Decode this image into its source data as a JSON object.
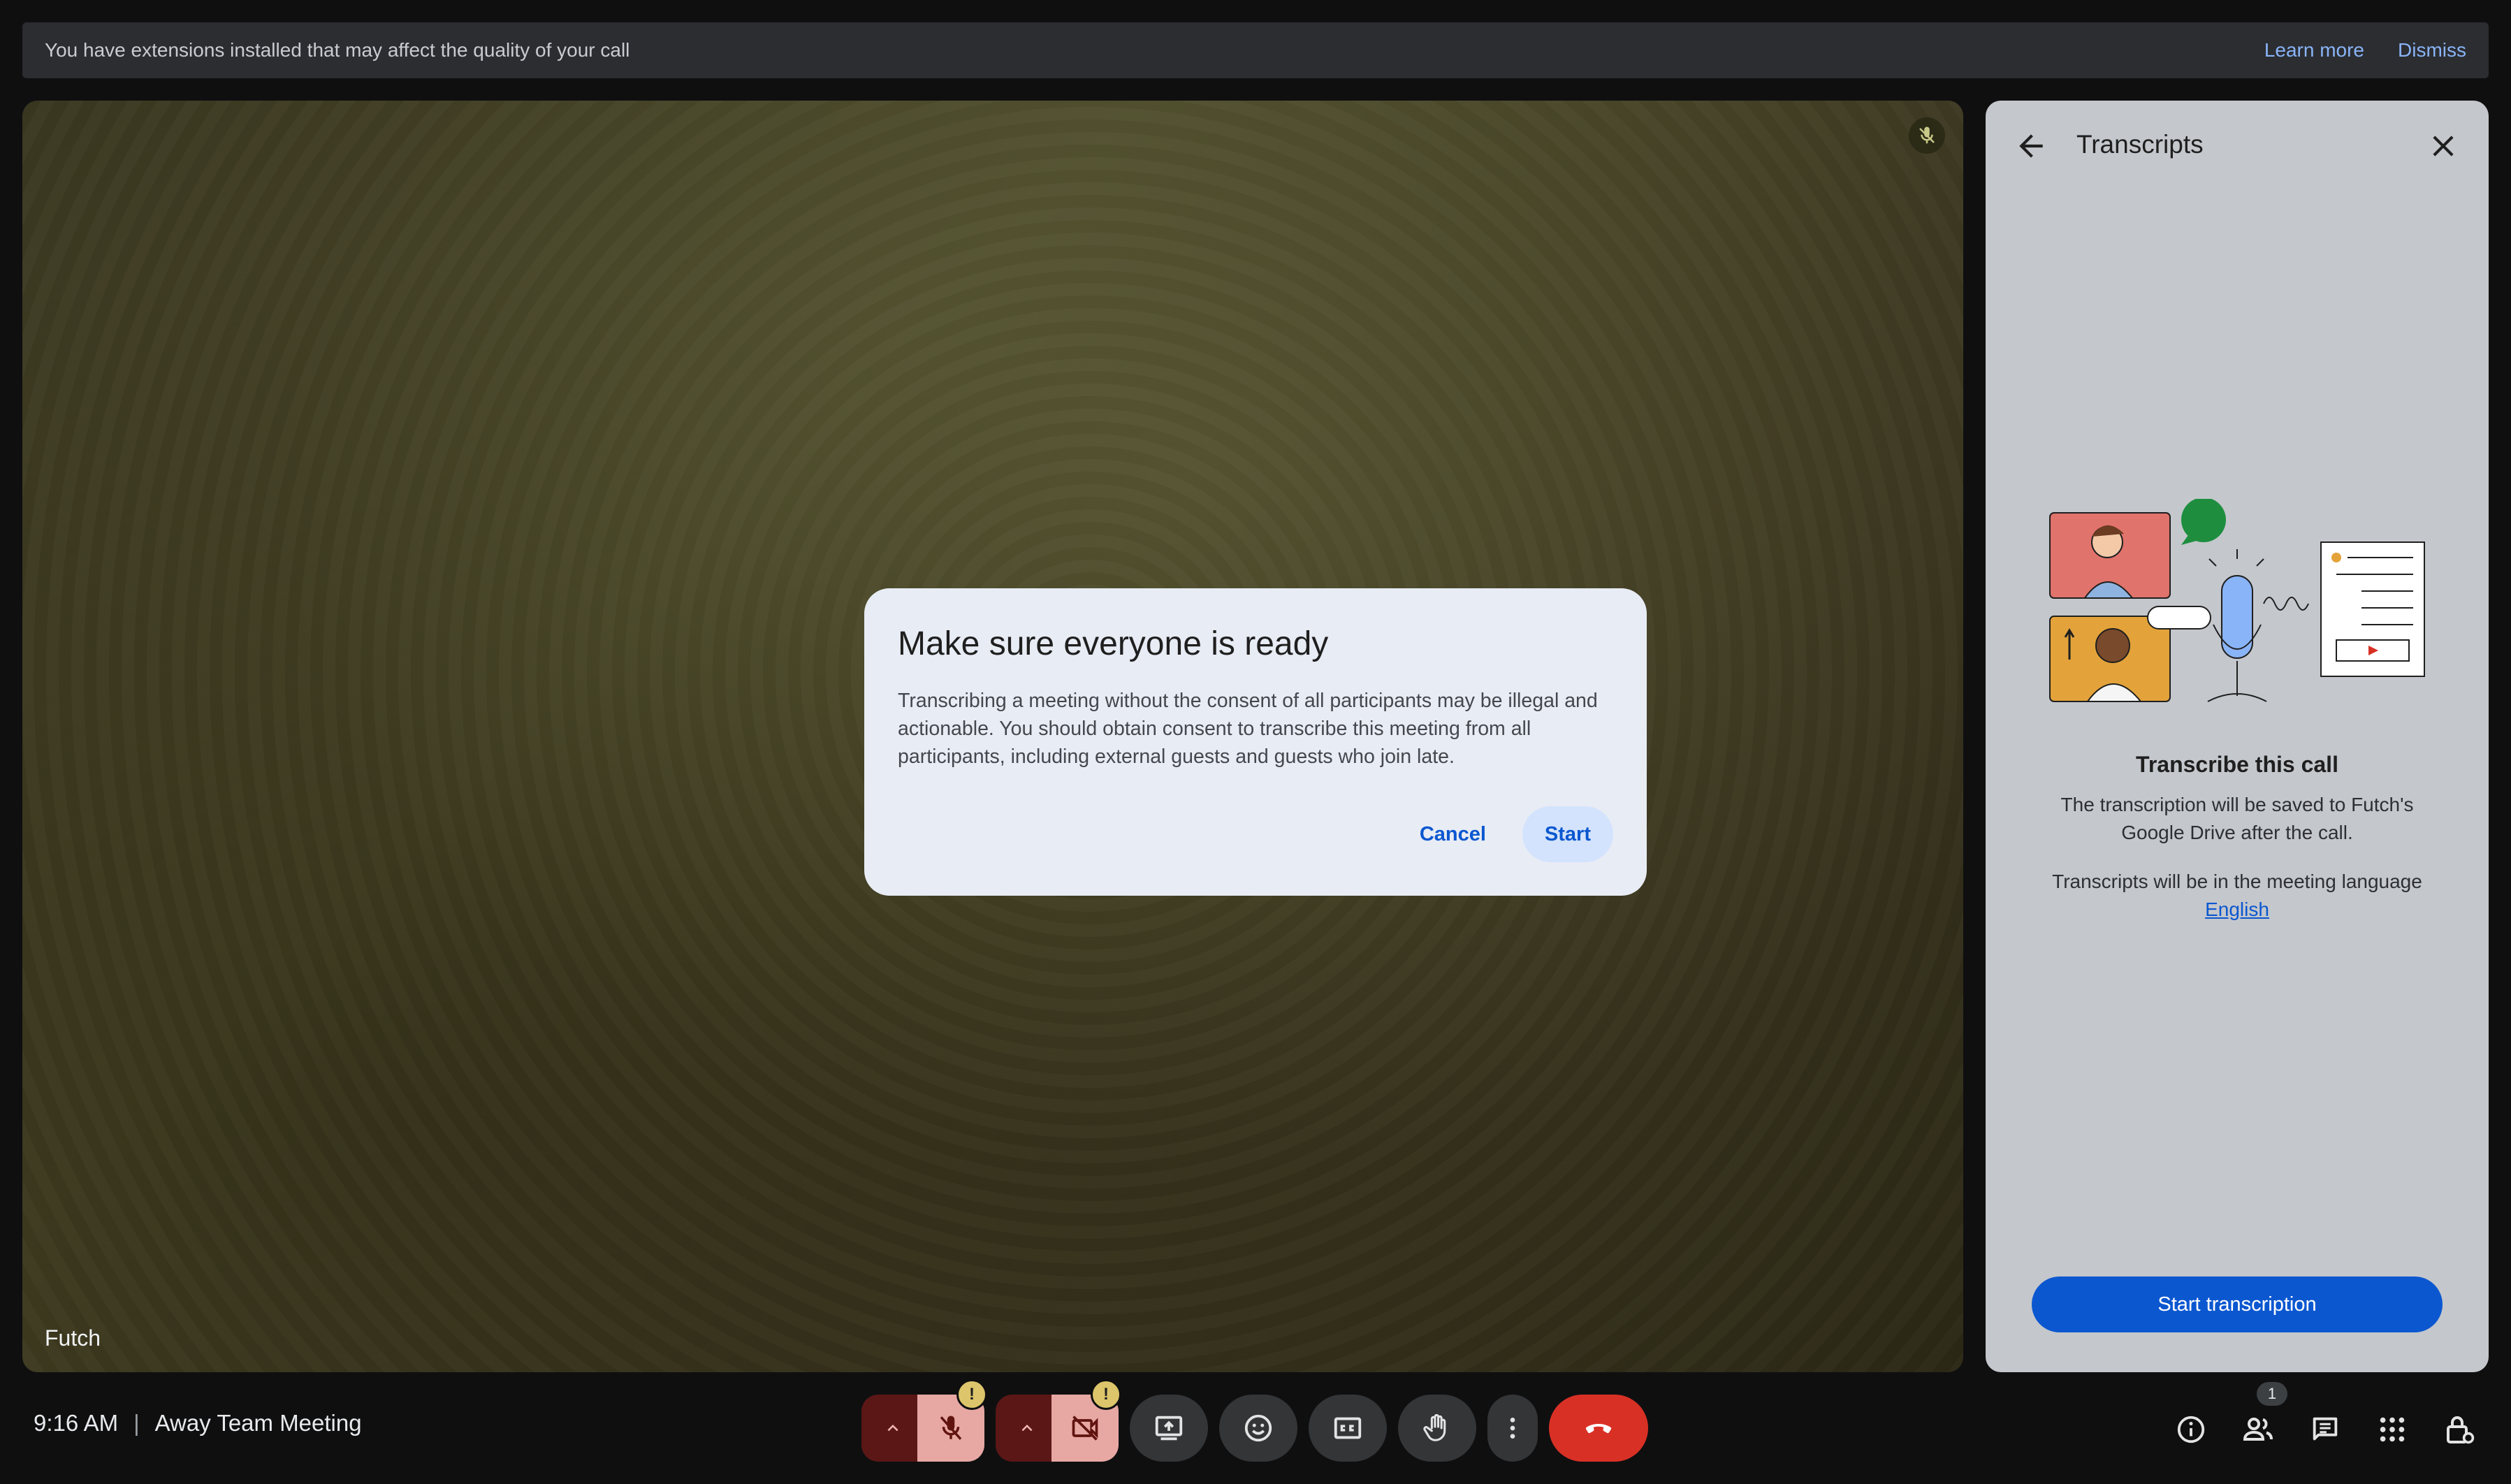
{
  "banner": {
    "message": "You have extensions installed that may affect the quality of your call",
    "learn_more": "Learn more",
    "dismiss": "Dismiss"
  },
  "video": {
    "participant_name": "Futch"
  },
  "dialog": {
    "title": "Make sure everyone is ready",
    "body": "Transcribing a meeting without the consent of all participants may be illegal and actionable. You should obtain consent to transcribe this meeting from all participants, including external guests and guests who join late.",
    "cancel_label": "Cancel",
    "start_label": "Start"
  },
  "panel": {
    "title": "Transcripts",
    "heading": "Transcribe this call",
    "saved_text": "The transcription will be saved to Futch's Google Drive after the call.",
    "language_text": "Transcripts will be in the meeting language",
    "language_link": "English",
    "start_button": "Start transcription"
  },
  "bottom_bar": {
    "time": "9:16 AM",
    "separator": "|",
    "meeting_name": "Away Team Meeting",
    "people_count": "1",
    "warning_mark": "!",
    "controls": [
      "mic-options-caret",
      "mic-off-icon",
      "camera-options-caret",
      "camera-off-icon",
      "present-screen-icon",
      "emoji-icon",
      "captions-icon",
      "raise-hand-icon",
      "more-options-icon",
      "leave-call-icon"
    ],
    "right_icons": [
      "info-icon",
      "people-icon",
      "chat-icon",
      "activities-icon",
      "host-controls-icon"
    ]
  },
  "colors": {
    "accent": "#0b57d0",
    "leave_red": "#d93025",
    "warning": "#dcc56a"
  }
}
